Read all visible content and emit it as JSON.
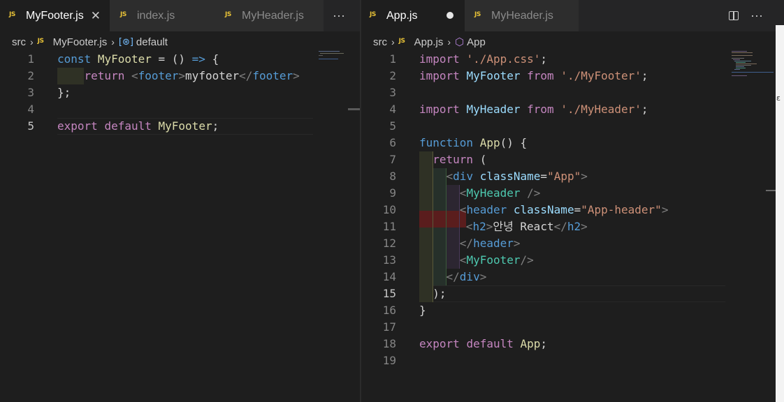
{
  "left": {
    "tabs": [
      {
        "label": "MyFooter.js",
        "active": true,
        "close": "✕"
      },
      {
        "label": "index.js",
        "active": false
      },
      {
        "label": "MyHeader.js",
        "active": false
      }
    ],
    "more": "···",
    "breadcrumb": {
      "folder": "src",
      "file": "MyFooter.js",
      "symbol": "default"
    },
    "lines": [
      "1",
      "2",
      "3",
      "4",
      "5"
    ],
    "current_line": "5",
    "code": {
      "l1": {
        "kw": "const",
        "name": "MyFooter",
        "rest": " = () ",
        "arrow": "=>",
        "brace": " {"
      },
      "l2": {
        "kw": "return",
        "open_lt": "<",
        "tag": "footer",
        "open_gt": ">",
        "text": "myfooter",
        "close_lt": "</",
        "close_tag": "footer",
        "close_gt": ">"
      },
      "l3": "};",
      "l5": {
        "kw1": "export",
        "kw2": "default",
        "name": "MyFooter",
        "semi": ";"
      }
    }
  },
  "right": {
    "tabs": [
      {
        "label": "App.js",
        "active": true
      },
      {
        "label": "MyHeader.js",
        "active": false
      }
    ],
    "more": "···",
    "breadcrumb": {
      "folder": "src",
      "file": "App.js",
      "symbol": "App"
    },
    "lines": [
      "1",
      "2",
      "3",
      "4",
      "5",
      "6",
      "7",
      "8",
      "9",
      "10",
      "11",
      "12",
      "13",
      "14",
      "15",
      "16",
      "17",
      "18",
      "19"
    ],
    "current_line": "15",
    "code": {
      "l1": {
        "kw": "import",
        "str": "'./App.css'",
        "semi": ";"
      },
      "l2": {
        "kw": "import",
        "name": "MyFooter",
        "from": "from",
        "str": "'./MyFooter'",
        "semi": ";"
      },
      "l4": {
        "kw": "import",
        "name": "MyHeader",
        "from": "from",
        "str": "'./MyHeader'",
        "semi": ";"
      },
      "l6": {
        "kw": "function",
        "name": "App",
        "rest": "() {"
      },
      "l7": {
        "kw": "return",
        "rest": " ("
      },
      "l8": {
        "lt": "<",
        "tag": "div",
        "attr": "className",
        "eq": "=",
        "str": "\"App\"",
        "gt": ">"
      },
      "l9": {
        "lt": "<",
        "comp": "MyHeader",
        "end": " />"
      },
      "l10": {
        "lt": "<",
        "tag": "header",
        "attr": "className",
        "eq": "=",
        "str": "\"App-header\"",
        "gt": ">"
      },
      "l11": {
        "lt": "<",
        "tag": "h2",
        "gt": ">",
        "text": "안녕 React",
        "clt": "</",
        "ctag": "h2",
        "cgt": ">"
      },
      "l12": {
        "lt": "</",
        "tag": "header",
        "gt": ">"
      },
      "l13": {
        "lt": "<",
        "comp": "MyFooter",
        "end": "/>"
      },
      "l14": {
        "lt": "</",
        "tag": "div",
        "gt": ">"
      },
      "l15": ");",
      "l16": "}",
      "l18": {
        "kw1": "export",
        "kw2": "default",
        "name": "App",
        "semi": ";"
      }
    }
  },
  "colors": {
    "background": "#1e1e1e",
    "tabbar": "#252526",
    "keyword": "#569cd6",
    "control": "#c586c0",
    "function": "#dcdcaa",
    "string": "#ce9178",
    "component": "#4ec9b0"
  }
}
